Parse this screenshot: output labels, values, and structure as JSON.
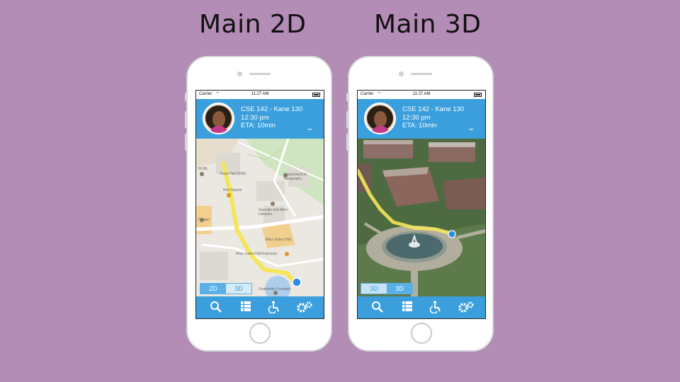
{
  "titles": {
    "left": "Main 2D",
    "right": "Main 3D"
  },
  "screens": [
    {
      "status": {
        "carrier": "Carrier",
        "time": "11:27 AM"
      },
      "header": {
        "line1": "CSE 142 - Kane 130",
        "line2": "12:30 pm",
        "line3": "ETA: 10min"
      },
      "map": {
        "labels": [
          "Kane Hall (KNE)",
          "Red Square",
          "Department of Geography",
          "Suzzallo and Allen Libraries",
          "Mary Gates Hall",
          "Mary Gates Hall Espresso",
          "Drumheller Fountain",
          "Theater",
          "(HUB)"
        ]
      },
      "toggle": {
        "a": "2D",
        "b": "3D",
        "active": "2D"
      }
    },
    {
      "status": {
        "carrier": "Carrier",
        "time": "11:27 AM"
      },
      "header": {
        "line1": "CSE 142 - Kane 130",
        "line2": "12:30 pm",
        "line3": "ETA: 10min"
      },
      "toggle": {
        "a": "3D",
        "b": "3D",
        "active": "3D"
      }
    }
  ],
  "tabs": [
    "search-icon",
    "list-icon",
    "accessibility-icon",
    "settings-icon"
  ],
  "colors": {
    "background": "#b38db5",
    "accent": "#3a9fdc",
    "route": "#f4e65a",
    "location": "#2a8fe0"
  }
}
